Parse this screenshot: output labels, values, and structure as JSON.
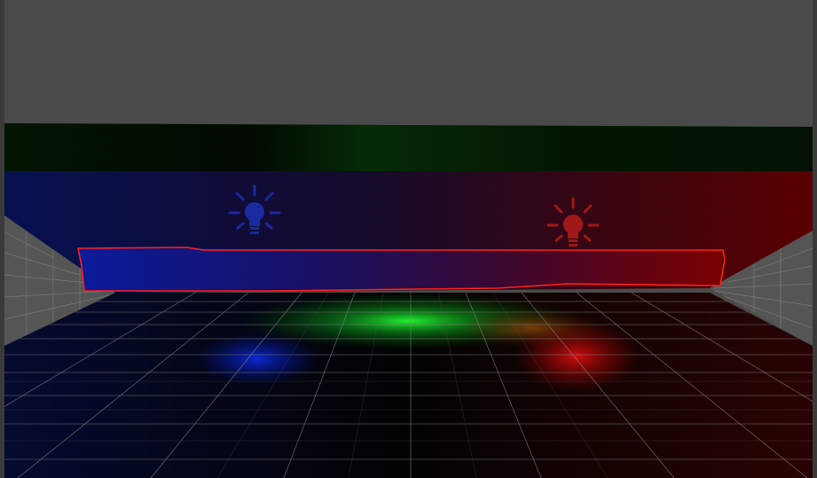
{
  "viewport": {
    "sky_color": "#4a4a4a",
    "frame_color": "#3a3a3a",
    "grid_color": "#8a8a8a"
  },
  "lights": [
    {
      "name": "blue-light",
      "icon": "lightbulb-icon",
      "color": "#1a2aa0"
    },
    {
      "name": "red-light",
      "icon": "lightbulb-icon",
      "color": "#a01818"
    }
  ],
  "selection": {
    "color": "#ff2020"
  },
  "glows": {
    "blue": "#1030ff",
    "green": "#20ff30",
    "red": "#ff1010"
  }
}
